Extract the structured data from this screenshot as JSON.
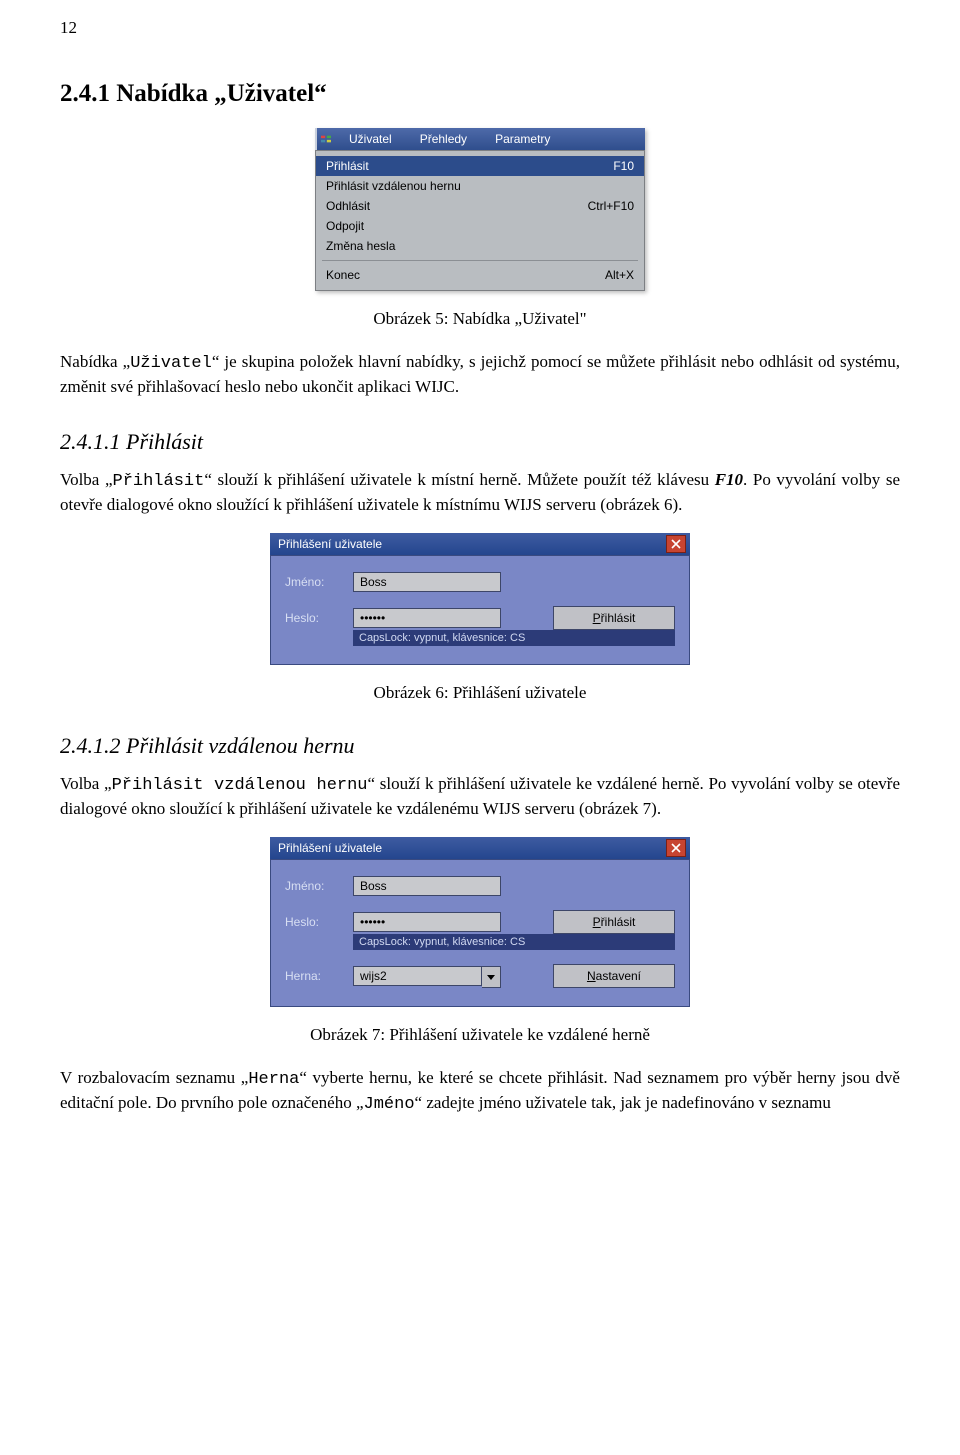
{
  "page_number": "12",
  "section_2_4_1_title": "2.4.1  Nabídka „Uživatel“",
  "caption_fig5": "Obrázek 5: Nabídka „Uživatel\"",
  "para1_a": "Nabídka „",
  "para1_b": "Uživatel",
  "para1_c": "“ je skupina položek hlavní nabídky, s jejichž pomocí se můžete přihlásit nebo odhlásit od systému, změnit své přihlašovací heslo nebo ukončit aplikaci WIJC.",
  "section_2_4_1_1_title": "2.4.1.1  Přihlásit",
  "para2_a": "Volba „",
  "para2_b": "Přihlásit",
  "para2_c": "“ slouží k přihlášení uživatele k místní herně. Můžete použít též klávesu ",
  "para2_d": "F10",
  "para2_e": ". Po vyvolání volby se otevře dialogové okno sloužící k přihlášení uživatele k místnímu WIJS serveru (obrázek 6).",
  "caption_fig6": "Obrázek 6: Přihlášení uživatele",
  "section_2_4_1_2_title": "2.4.1.2  Přihlásit vzdálenou hernu",
  "para3_a": "Volba „",
  "para3_b": "Přihlásit vzdálenou hernu",
  "para3_c": "“ slouží k přihlášení uživatele ke vzdálené herně. Po vyvolání volby se otevře dialogové okno sloužící k přihlášení uživatele ke vzdálenému WIJS serveru (obrázek 7).",
  "caption_fig7": "Obrázek 7: Přihlášení uživatele ke vzdálené herně",
  "para4_a": "V rozbalovacím seznamu „",
  "para4_b": "Herna",
  "para4_c": "“ vyberte hernu, ke které se chcete přihlásit. Nad seznamem pro výběr herny jsou dvě editační pole. Do prvního pole označeného „",
  "para4_d": "Jméno",
  "para4_e": "“ zadejte jméno uživatele tak, jak je nadefinováno v seznamu",
  "menu": {
    "menubar_items": [
      "Uživatel",
      "Přehledy",
      "Parametry"
    ],
    "items": {
      "0": {
        "label": "Přihlásit",
        "shortcut": "F10"
      },
      "1": {
        "label": "Přihlásit vzdálenou hernu",
        "shortcut": ""
      },
      "2": {
        "label": "Odhlásit",
        "shortcut": "Ctrl+F10"
      },
      "3": {
        "label": "Odpojit",
        "shortcut": ""
      },
      "4": {
        "label": "Změna hesla",
        "shortcut": ""
      },
      "5": {
        "label": "Konec",
        "shortcut": "Alt+X"
      }
    }
  },
  "dlg6": {
    "title": "Přihlášení uživatele",
    "lbl_jmeno": "Jméno:",
    "val_jmeno": "Boss",
    "lbl_heslo": "Heslo:",
    "val_heslo": "••••••",
    "btn_prihlasit_pre": "P",
    "btn_prihlasit_rest": "řihlásit",
    "status": "CapsLock: vypnut, klávesnice: CS"
  },
  "dlg7": {
    "title": "Přihlášení uživatele",
    "lbl_jmeno": "Jméno:",
    "val_jmeno": "Boss",
    "lbl_heslo": "Heslo:",
    "val_heslo": "••••••",
    "btn_prihlasit_pre": "P",
    "btn_prihlasit_rest": "řihlásit",
    "status": "CapsLock: vypnut, klávesnice: CS",
    "lbl_herna": "Herna:",
    "val_herna": "wijs2",
    "btn_nastaveni_pre": "N",
    "btn_nastaveni_rest": "astavení"
  }
}
